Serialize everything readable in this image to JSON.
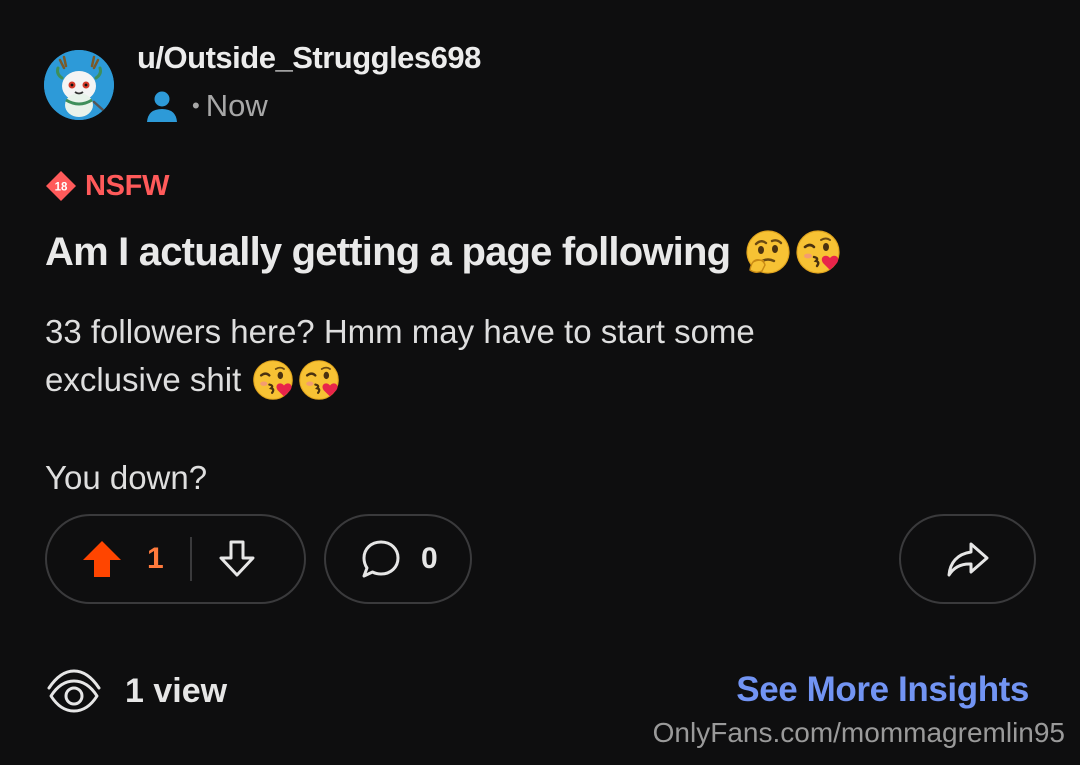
{
  "post": {
    "username": "u/Outside_Struggles698",
    "separator": "•",
    "timestamp": "Now",
    "nsfw_badge": "18",
    "nsfw_label": "NSFW",
    "title": "Am I actually getting a page following",
    "title_emojis": [
      "thinking-face-emoji",
      "kissing-heart-emoji"
    ],
    "body_line1": "33 followers here? Hmm may have to start some",
    "body_line2": "exclusive shit",
    "body_line2_emojis": [
      "kissing-heart-emoji",
      "kissing-heart-emoji"
    ],
    "body_line3": "You down?"
  },
  "actions": {
    "upvote_count": "1",
    "comment_count": "0"
  },
  "footer": {
    "views_label": "1 view",
    "insights_link": "See More Insights"
  },
  "watermark": "OnlyFans.com/mommagremlin95",
  "colors": {
    "background": "#0e0e0f",
    "upvote": "#ff4500",
    "nsfw": "#ff5a5a",
    "link": "#7294f3",
    "pill_border": "#3a3a3c",
    "user_icon": "#2d9ad8"
  }
}
